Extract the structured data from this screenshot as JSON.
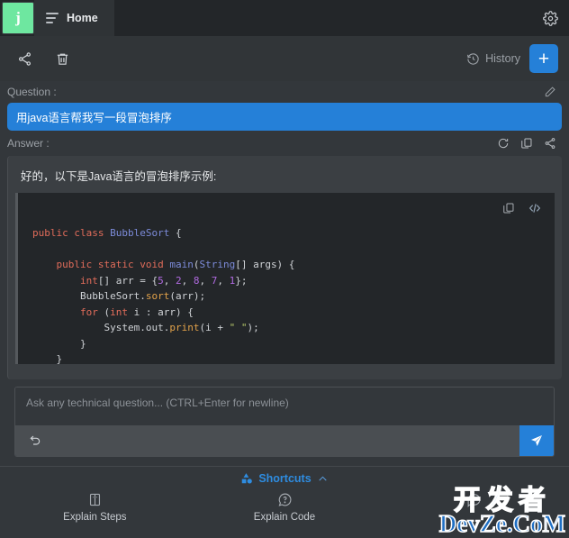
{
  "titlebar": {
    "logo_letter": "j",
    "tab_label": "Home",
    "menu_icon": "hamburger-icon",
    "settings_icon": "gear-icon"
  },
  "toolbar": {
    "share_icon": "share-icon",
    "delete_icon": "trash-icon",
    "history_label": "History",
    "history_icon": "clock-rewind-icon",
    "new_chat_label": "+"
  },
  "conversation": {
    "question_label": "Question :",
    "question_edit_icon": "pencil-icon",
    "question_text": "用java语言帮我写一段冒泡排序",
    "answer_label": "Answer :",
    "answer_icons": [
      "refresh-icon",
      "copy-icon",
      "share-icon"
    ],
    "answer_intro": "好的，以下是Java语言的冒泡排序示例:",
    "code_header_icons": [
      "copy-icon",
      "code-icon"
    ],
    "code_lines": [
      [
        {
          "t": "public ",
          "c": "k"
        },
        {
          "t": "class ",
          "c": "k"
        },
        {
          "t": "BubbleSort",
          "c": "ty"
        },
        {
          "t": " {",
          "c": "pl"
        }
      ],
      [
        {
          "t": "",
          "c": "pl"
        }
      ],
      [
        {
          "t": "    public static void ",
          "c": "k"
        },
        {
          "t": "main",
          "c": "ty"
        },
        {
          "t": "(",
          "c": "pl"
        },
        {
          "t": "String",
          "c": "ty"
        },
        {
          "t": "[] args) {",
          "c": "pl"
        }
      ],
      [
        {
          "t": "        ",
          "c": "pl"
        },
        {
          "t": "int",
          "c": "k"
        },
        {
          "t": "[] arr = {",
          "c": "pl"
        },
        {
          "t": "5",
          "c": "num"
        },
        {
          "t": ", ",
          "c": "pl"
        },
        {
          "t": "2",
          "c": "num"
        },
        {
          "t": ", ",
          "c": "pl"
        },
        {
          "t": "8",
          "c": "num"
        },
        {
          "t": ", ",
          "c": "pl"
        },
        {
          "t": "7",
          "c": "num"
        },
        {
          "t": ", ",
          "c": "pl"
        },
        {
          "t": "1",
          "c": "num"
        },
        {
          "t": "};",
          "c": "pl"
        }
      ],
      [
        {
          "t": "        BubbleSort.",
          "c": "pl"
        },
        {
          "t": "sort",
          "c": "fn"
        },
        {
          "t": "(arr);",
          "c": "pl"
        }
      ],
      [
        {
          "t": "        ",
          "c": "pl"
        },
        {
          "t": "for",
          "c": "k"
        },
        {
          "t": " (",
          "c": "pl"
        },
        {
          "t": "int",
          "c": "k"
        },
        {
          "t": " i : arr) {",
          "c": "pl"
        }
      ],
      [
        {
          "t": "            System.out.",
          "c": "pl"
        },
        {
          "t": "print",
          "c": "fn"
        },
        {
          "t": "(i + ",
          "c": "pl"
        },
        {
          "t": "\" \"",
          "c": "st"
        },
        {
          "t": ");",
          "c": "pl"
        }
      ],
      [
        {
          "t": "        }",
          "c": "pl"
        }
      ],
      [
        {
          "t": "    }",
          "c": "pl"
        }
      ]
    ]
  },
  "input": {
    "placeholder": "Ask any technical question... (CTRL+Enter for newline)",
    "value": "",
    "undo_icon": "undo-icon",
    "send_icon": "send-icon"
  },
  "shortcuts": {
    "header_label": "Shortcuts",
    "header_icon": "shapes-icon",
    "collapse_icon": "chevron-up-icon",
    "items": [
      {
        "label": "Explain Steps",
        "icon": "book-icon"
      },
      {
        "label": "Explain Code",
        "icon": "question-bubble-icon"
      },
      {
        "label": "",
        "icon": "comment-icon"
      }
    ]
  },
  "watermark": {
    "cn": "开发者",
    "en": "DevZe.CoM"
  }
}
